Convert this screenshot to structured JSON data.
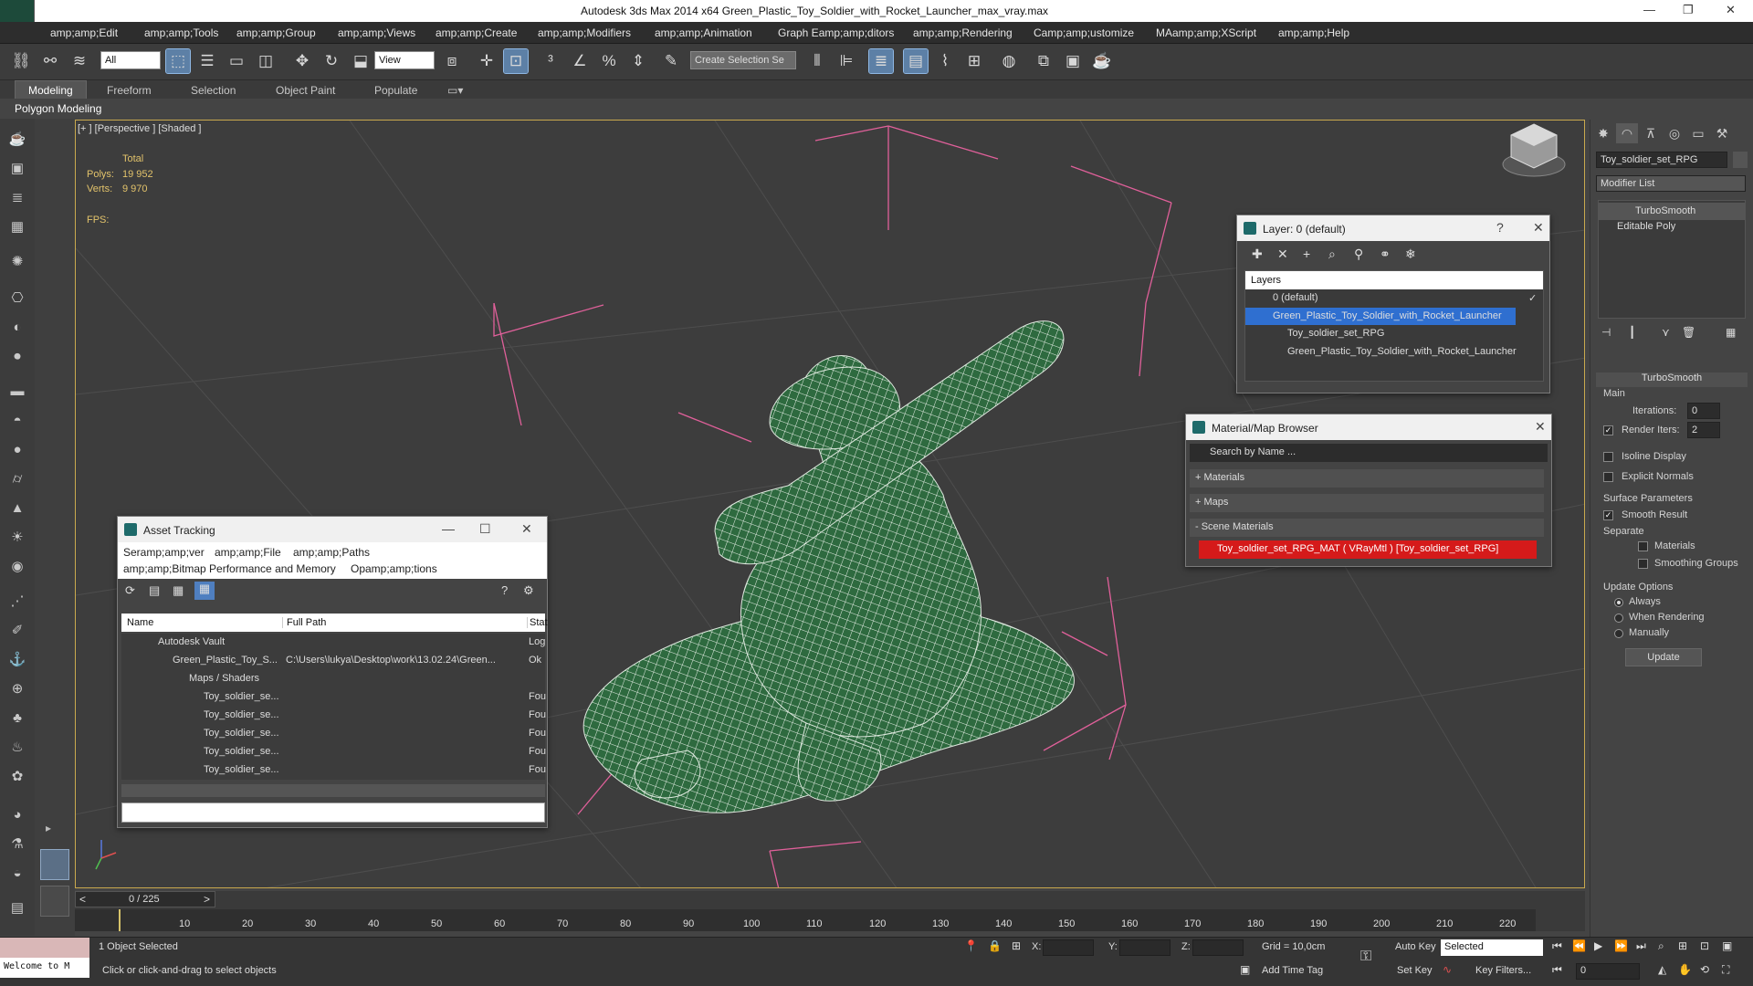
{
  "window": {
    "title": "Autodesk 3ds Max  2014 x64     Green_Plastic_Toy_Soldier_with_Rocket_Launcher_max_vray.max"
  },
  "menu": [
    "amp;amp;Edit",
    "amp;amp;Tools",
    "amp;amp;Group",
    "amp;amp;Views",
    "amp;amp;Create",
    "amp;amp;Modifiers",
    "amp;amp;Animation",
    "Graph Eamp;amp;ditors",
    "amp;amp;Rendering",
    "Camp;amp;ustomize",
    "MAamp;amp;XScript",
    "amp;amp;Help"
  ],
  "toolbar": {
    "filter": "All",
    "refcoord": "View",
    "selset": "Create Selection Se"
  },
  "ribbon": {
    "tabs": [
      "Modeling",
      "Freeform",
      "Selection",
      "Object Paint",
      "Populate"
    ],
    "sub": "Polygon Modeling"
  },
  "viewport": {
    "label": "[+ ] [Perspective ] [Shaded ]",
    "total": "Total",
    "polys_label": "Polys:",
    "polys": "19 952",
    "verts_label": "Verts:",
    "verts": "9 970",
    "fps": "FPS:"
  },
  "layer_dialog": {
    "title": "Layer: 0 (default)",
    "help": "?",
    "header": "Layers",
    "items": [
      {
        "label": "0 (default)"
      },
      {
        "label": "Green_Plastic_Toy_Soldier_with_Rocket_Launcher"
      },
      {
        "label": "Toy_soldier_set_RPG"
      },
      {
        "label": "Green_Plastic_Toy_Soldier_with_Rocket_Launcher"
      }
    ]
  },
  "material_browser": {
    "title": "Material/Map Browser",
    "search": "Search by Name ...",
    "sections": [
      "+ Materials",
      "+ Maps",
      "- Scene Materials"
    ],
    "scene_material": "Toy_soldier_set_RPG_MAT  ( VRayMtl ) [Toy_soldier_set_RPG]",
    "swatch": "#d51a1a"
  },
  "asset_tracking": {
    "title": "Asset Tracking",
    "menu1": [
      "Seramp;amp;ver",
      "amp;amp;File",
      "amp;amp;Paths"
    ],
    "menu2": [
      "amp;amp;Bitmap Performance and Memory",
      "Opamp;amp;tions"
    ],
    "columns": [
      "Name",
      "Full Path",
      "Stat"
    ],
    "rows": [
      {
        "name": "Autodesk Vault",
        "path": "",
        "status": "Log"
      },
      {
        "name": "Green_Plastic_Toy_S...",
        "path": "C:\\Users\\lukya\\Desktop\\work\\13.02.24\\Green...",
        "status": "Ok"
      },
      {
        "name": "Maps / Shaders",
        "path": "",
        "status": ""
      },
      {
        "name": "Toy_soldier_se...",
        "path": "",
        "status": "Fou"
      },
      {
        "name": "Toy_soldier_se...",
        "path": "",
        "status": "Fou"
      },
      {
        "name": "Toy_soldier_se...",
        "path": "",
        "status": "Fou"
      },
      {
        "name": "Toy_soldier_se...",
        "path": "",
        "status": "Fou"
      },
      {
        "name": "Toy_soldier_se...",
        "path": "",
        "status": "Fou"
      }
    ]
  },
  "command_panel": {
    "object_name": "Toy_soldier_set_RPG",
    "modifier_list": "Modifier List",
    "stack": [
      "TurboSmooth",
      "Editable Poly"
    ],
    "rollout": "TurboSmooth",
    "main": "Main",
    "iterations_label": "Iterations:",
    "iterations": "0",
    "render_iters_label": "Render Iters:",
    "render_iters": "2",
    "isoline": "Isoline Display",
    "explicit": "Explicit Normals",
    "surface": "Surface Parameters",
    "smooth": "Smooth Result",
    "separate": "Separate",
    "materials": "Materials",
    "smoothing": "Smoothing Groups",
    "update_options": "Update Options",
    "always": "Always",
    "when_rendering": "When Rendering",
    "manually": "Manually",
    "update": "Update"
  },
  "timeline": {
    "frame": "0 / 225",
    "ticks": [
      "10",
      "20",
      "30",
      "40",
      "50",
      "60",
      "70",
      "80",
      "90",
      "100",
      "110",
      "120",
      "130",
      "140",
      "150",
      "160",
      "170",
      "180",
      "190",
      "200",
      "210",
      "220"
    ]
  },
  "status": {
    "welcome": "Welcome to M",
    "selected": "1 Object Selected",
    "prompt": "Click or click-and-drag to select objects",
    "x": "X:",
    "y": "Y:",
    "z": "Z:",
    "grid": "Grid = 10,0cm",
    "add_time_tag": "Add Time Tag",
    "auto_key": "Auto Key",
    "set_key": "Set Key",
    "key_mode": "Selected",
    "key_filters": "Key Filters...",
    "frame": "0"
  }
}
